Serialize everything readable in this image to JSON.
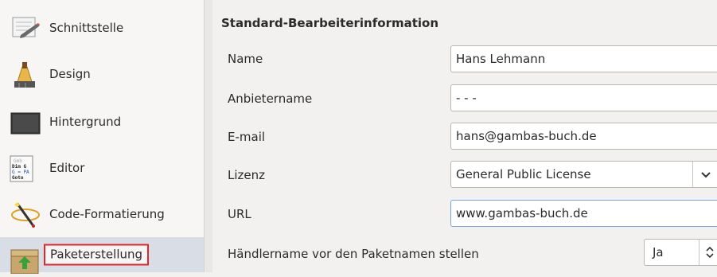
{
  "sidebar": {
    "items": [
      {
        "label": "Schnittstelle",
        "icon": "interface-icon"
      },
      {
        "label": "Design",
        "icon": "paint-brush-icon"
      },
      {
        "label": "Hintergrund",
        "icon": "background-icon"
      },
      {
        "label": "Editor",
        "icon": "editor-code-icon"
      },
      {
        "label": "Code-Formatierung",
        "icon": "code-format-wand-icon"
      },
      {
        "label": "Paketerstellung",
        "icon": "package-icon",
        "selected": true
      }
    ]
  },
  "main": {
    "section_title": "Standard-Bearbeiterinformation",
    "fields": {
      "name": {
        "label": "Name",
        "value": "Hans Lehmann"
      },
      "vendor": {
        "label": "Anbietername",
        "value": "- - -"
      },
      "email": {
        "label": "E-mail",
        "value": "hans@gambas-buch.de"
      },
      "license": {
        "label": "Lizenz",
        "value": "General Public License"
      },
      "url": {
        "label": "URL",
        "value": "www.gambas-buch.de"
      },
      "vendor_prefix": {
        "label": "Händlername vor den Paketnamen stellen",
        "value": "Ja"
      }
    }
  },
  "colors": {
    "selection_bg": "#d9dee6",
    "highlight_border": "#e0262b",
    "focus_border": "#7aa6da"
  }
}
